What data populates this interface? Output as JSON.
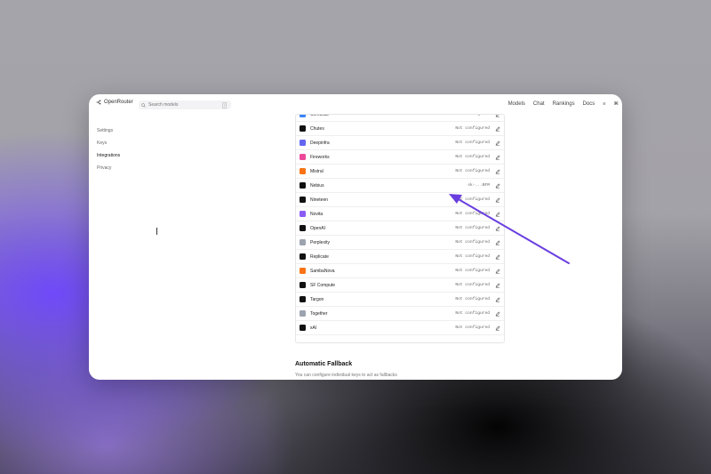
{
  "header": {
    "brand": "OpenRouter",
    "search_placeholder": "Search models",
    "search_shortcut": "/",
    "nav": [
      "Models",
      "Chat",
      "Rankings",
      "Docs"
    ]
  },
  "sidebar": {
    "items": [
      "Settings",
      "Keys",
      "Integrations",
      "Privacy"
    ],
    "active": "Integrations"
  },
  "providers": [
    {
      "name": "Cerebras",
      "status": "Not configured",
      "icon_color": "#3b82f6",
      "icon": "cerebras-icon"
    },
    {
      "name": "Chutes",
      "status": "Not configured",
      "icon_color": "#111111",
      "icon": "chutes-icon"
    },
    {
      "name": "Deepinfra",
      "status": "Not configured",
      "icon_color": "#6366f1",
      "icon": "bolt-icon"
    },
    {
      "name": "Fireworks",
      "status": "Not configured",
      "icon_color": "#ec4899",
      "icon": "fireworks-icon"
    },
    {
      "name": "Mistral",
      "status": "Not configured",
      "icon_color": "#f97316",
      "icon": "mistral-icon"
    },
    {
      "name": "Nebius",
      "status": "sk-...BFM",
      "icon_color": "#111111",
      "icon": "nebius-icon"
    },
    {
      "name": "Nineteen",
      "status": "Not configured",
      "icon_color": "#111111",
      "icon": "nineteen-icon"
    },
    {
      "name": "Novita",
      "status": "Not configured",
      "icon_color": "#8b5cf6",
      "icon": "novita-icon"
    },
    {
      "name": "OpenAI",
      "status": "Not configured",
      "icon_color": "#111111",
      "icon": "openai-icon"
    },
    {
      "name": "Perplexity",
      "status": "Not configured",
      "icon_color": "#9ca3af",
      "icon": "perplexity-icon"
    },
    {
      "name": "Replicate",
      "status": "Not configured",
      "icon_color": "#111111",
      "icon": "replicate-icon"
    },
    {
      "name": "SambaNova",
      "status": "Not configured",
      "icon_color": "#f97316",
      "icon": "sambanova-icon"
    },
    {
      "name": "SF Compute",
      "status": "Not configured",
      "icon_color": "#111111",
      "icon": "sfcompute-icon"
    },
    {
      "name": "Targon",
      "status": "Not configured",
      "icon_color": "#111111",
      "icon": "targon-icon"
    },
    {
      "name": "Together",
      "status": "Not configured",
      "icon_color": "#9ca3af",
      "icon": "together-icon"
    },
    {
      "name": "xAI",
      "status": "Not configured",
      "icon_color": "#111111",
      "icon": "xai-icon"
    }
  ],
  "fallback": {
    "title": "Automatic Fallback",
    "description": "You can configure individual keys to act as fallbacks"
  },
  "colors": {
    "arrow": "#6a3fe0",
    "accent_purple": "#6d3cf5"
  }
}
